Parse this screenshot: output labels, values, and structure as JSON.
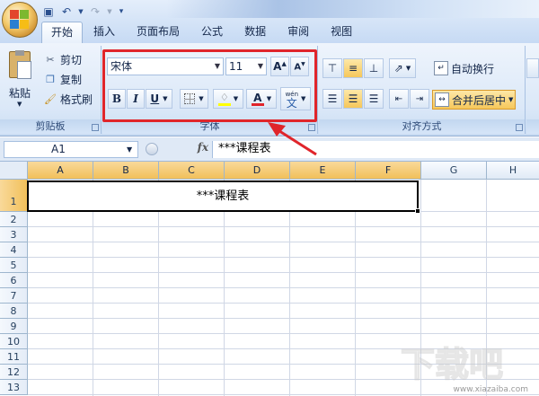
{
  "quick_access": {
    "icons": [
      "save-icon",
      "undo-icon",
      "redo-icon",
      "customize-icon"
    ]
  },
  "tabs": [
    "开始",
    "插入",
    "页面布局",
    "公式",
    "数据",
    "审阅",
    "视图"
  ],
  "clipboard": {
    "paste_label": "粘贴",
    "cut_label": "剪切",
    "copy_label": "复制",
    "format_painter_label": "格式刷",
    "group_label": "剪贴板"
  },
  "font": {
    "font_name": "宋体",
    "font_size": "11",
    "bold": "B",
    "italic": "I",
    "underline": "U",
    "color_letter": "A",
    "phonetic_top": "wén",
    "phonetic_char": "文",
    "group_label": "字体",
    "accent_color": "#e0252b"
  },
  "alignment": {
    "wrap_label": "自动换行",
    "merge_label": "合并后居中",
    "group_label": "对齐方式"
  },
  "formula_bar": {
    "cell_ref": "A1",
    "fx": "fx",
    "content": "***课程表"
  },
  "sheet": {
    "columns": [
      "A",
      "B",
      "C",
      "D",
      "E",
      "F",
      "G",
      "H"
    ],
    "rows": [
      "1",
      "2",
      "3",
      "4",
      "5",
      "6",
      "7",
      "8",
      "9",
      "10",
      "11",
      "12",
      "13"
    ],
    "merged_cell_text": "***课程表"
  },
  "watermark": {
    "url": "www.xiazaiba.com"
  }
}
